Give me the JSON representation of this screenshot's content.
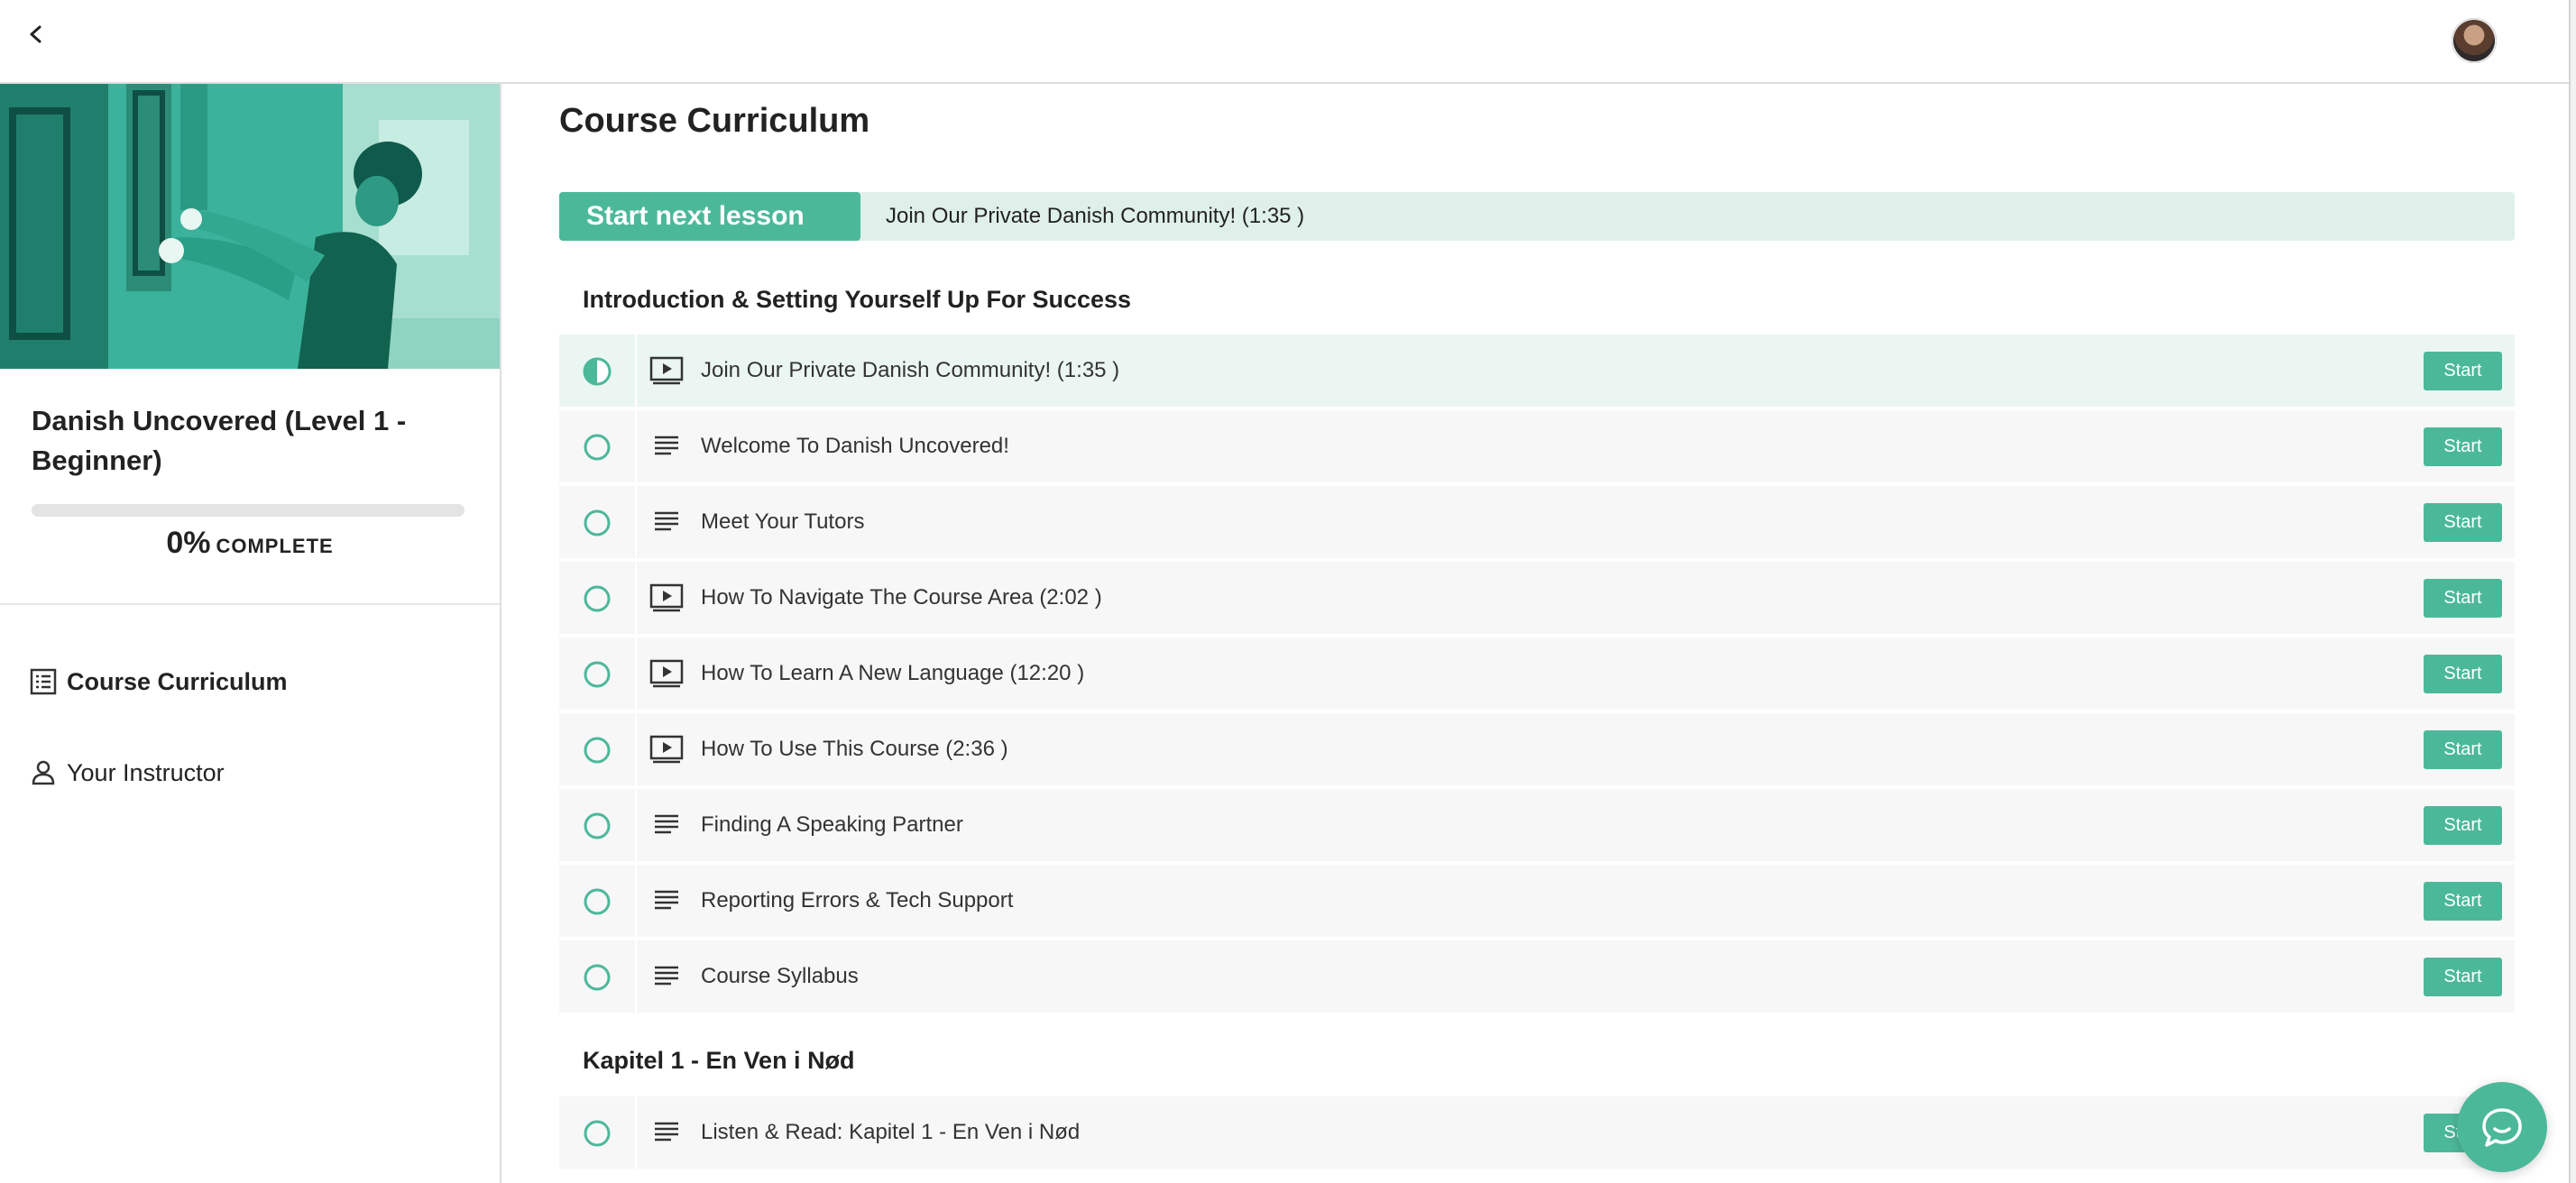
{
  "header": {
    "back_icon": "chevron-left-icon",
    "avatar": "user-avatar"
  },
  "sidebar": {
    "course_title": "Danish Uncovered (Level 1 - Beginner)",
    "progress": {
      "percent_text": "0%",
      "label": "COMPLETE",
      "value": 0
    },
    "nav": [
      {
        "label": "Course Curriculum",
        "icon": "curriculum-icon",
        "active": true
      },
      {
        "label": "Your Instructor",
        "icon": "person-icon",
        "active": false
      }
    ]
  },
  "main": {
    "title": "Course Curriculum",
    "next": {
      "button_label": "Start next lesson",
      "lesson": "Join Our Private Danish Community! (1:35 )"
    },
    "sections": [
      {
        "title": "Introduction & Setting Yourself Up For Success",
        "lessons": [
          {
            "title": "Join Our Private Danish Community! (1:35 )",
            "type": "video",
            "status": "in-progress",
            "button": "Start"
          },
          {
            "title": "Welcome To Danish Uncovered!",
            "type": "text",
            "status": "not-started",
            "button": "Start"
          },
          {
            "title": "Meet Your Tutors",
            "type": "text",
            "status": "not-started",
            "button": "Start"
          },
          {
            "title": "How To Navigate The Course Area (2:02 )",
            "type": "video",
            "status": "not-started",
            "button": "Start"
          },
          {
            "title": "How To Learn A New Language (12:20 )",
            "type": "video",
            "status": "not-started",
            "button": "Start"
          },
          {
            "title": "How To Use This Course (2:36 )",
            "type": "video",
            "status": "not-started",
            "button": "Start"
          },
          {
            "title": "Finding A Speaking Partner",
            "type": "text",
            "status": "not-started",
            "button": "Start"
          },
          {
            "title": "Reporting Errors & Tech Support",
            "type": "text",
            "status": "not-started",
            "button": "Start"
          },
          {
            "title": "Course Syllabus",
            "type": "text",
            "status": "not-started",
            "button": "Start"
          }
        ]
      },
      {
        "title": "Kapitel 1 - En Ven i Nød",
        "lessons": [
          {
            "title": "Listen & Read: Kapitel 1 - En Ven i Nød",
            "type": "text",
            "status": "not-started",
            "button": "Start"
          }
        ]
      }
    ]
  },
  "colors": {
    "accent": "#4cb89a",
    "accent_light": "#dff0ea",
    "row_bg": "#f7f7f7"
  },
  "chat": {
    "icon": "chat-icon"
  }
}
